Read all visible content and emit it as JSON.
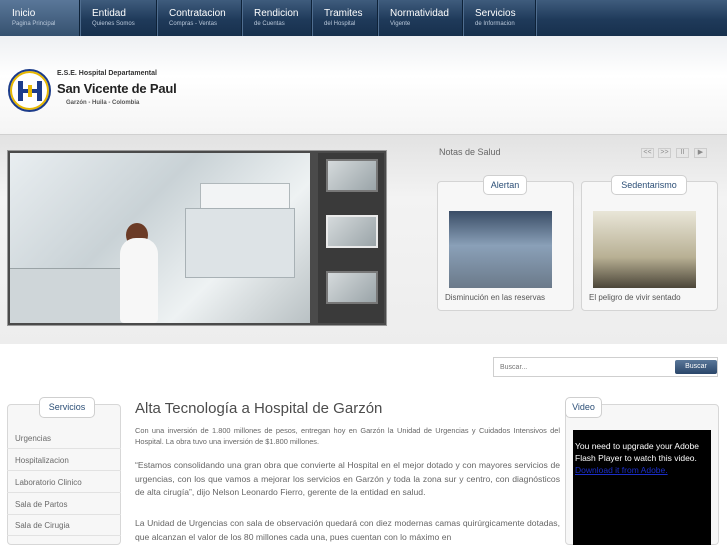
{
  "nav": {
    "items": [
      {
        "title": "Inicio",
        "sub": "Pagina Principal"
      },
      {
        "title": "Entidad",
        "sub": "Quienes Somos"
      },
      {
        "title": "Contratacion",
        "sub": "Compras - Ventas"
      },
      {
        "title": "Rendicion",
        "sub": "de Cuentas"
      },
      {
        "title": "Tramites",
        "sub": "del Hospital"
      },
      {
        "title": "Normatividad",
        "sub": "Vigente"
      },
      {
        "title": "Servicios",
        "sub": "de Informacion"
      }
    ]
  },
  "header": {
    "org": "E.S.E. Hospital Departamental",
    "name": "San Vicente de Paul",
    "place": "Garzón - Huila - Colombia"
  },
  "notas": {
    "title": "Notas de Salud",
    "controls": [
      "<<",
      ">>",
      "II",
      "▶"
    ],
    "cards": [
      {
        "tab": "Alertan",
        "caption": "Disminución en las reservas"
      },
      {
        "tab": "Sedentarismo",
        "caption": "El peligro de vivir sentado"
      }
    ]
  },
  "search": {
    "placeholder": "Buscar...",
    "button": "Buscar"
  },
  "sidebar": {
    "title": "Servicios",
    "items": [
      "Urgencias",
      "Hospitalizacion",
      "Laboratorio Clinico",
      "Sala de Partos",
      "Sala de Cirugia"
    ]
  },
  "article": {
    "title": "Alta Tecnología a Hospital de Garzón",
    "p1": "Con una inversión de 1.800 millones de pesos, entregan hoy en Garzón la Unidad de Urgencias y Cuidados Intensivos del Hospital. La obra tuvo una inversión de $1.800 millones.",
    "p2": "“Estamos consolidando una gran obra que convierte al Hospital en el mejor dotado y con mayores servicios de urgencias, con los que vamos a mejorar los servicios en Garzón y toda la zona sur y centro, con diagnósticos de alta cirugía”, dijo Nelson Leonardo Fierro, gerente de la entidad en salud.",
    "p3": "La Unidad de Urgencias con sala de observación quedará con diez modernas camas quirúrgicamente dotadas, que alcanzan el valor de los 80 millones cada una, pues cuentan con lo máximo en"
  },
  "video": {
    "title": "Video",
    "message": "You need to upgrade your Adobe Flash Player to watch this video.",
    "link": "Download it from Adobe."
  }
}
